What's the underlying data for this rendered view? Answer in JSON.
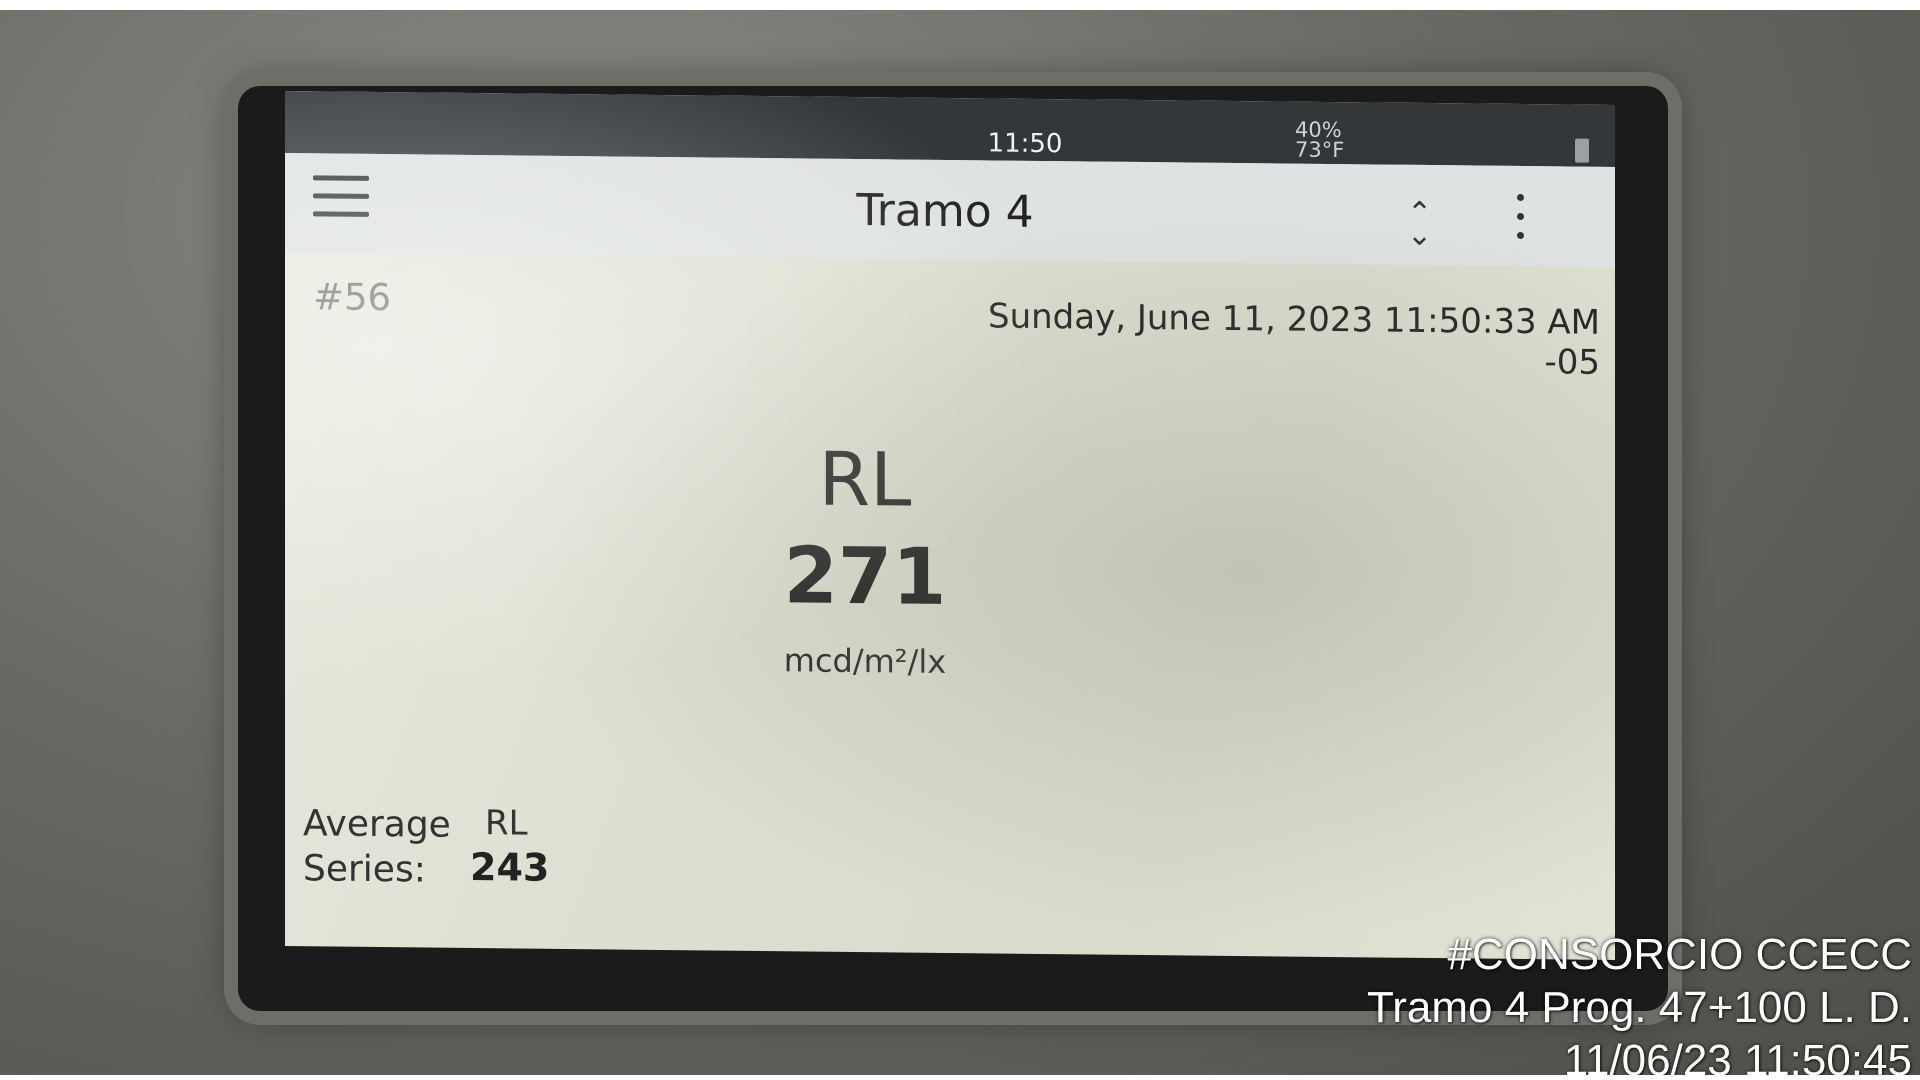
{
  "status_bar": {
    "time": "11:50",
    "sensor_readings": [
      "40%",
      "73°F"
    ]
  },
  "header": {
    "title": "Tramo 4",
    "menu_icon": "hamburger-menu-icon",
    "sort_icon": "up-down-chevron-icon",
    "more_icon": "vertical-ellipsis-icon"
  },
  "record": {
    "number": "#56",
    "datetime": "Sunday, June 11, 2023 11:50:33 AM -05"
  },
  "measurement": {
    "label": "RL",
    "value": "271",
    "unit": "mcd/m²/lx"
  },
  "average": {
    "label_line1": "Average",
    "label_line2": "Series:",
    "metric": "RL",
    "value": "243"
  },
  "photo_overlay": {
    "line1": "#CONSORCIO CCECC",
    "line2": "Tramo 4 Prog. 47+100 L. D.",
    "line3": "11/06/23  11:50:45"
  },
  "colors": {
    "screen_background": "#dcdfd0",
    "status_bar": "#33373a",
    "header_bar": "#dfe2e2",
    "overlay_text": "#ffffff"
  }
}
